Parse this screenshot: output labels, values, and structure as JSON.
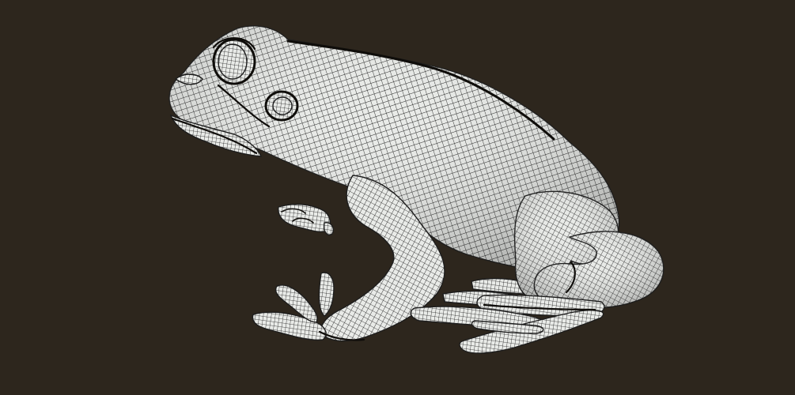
{
  "scene": {
    "subject_icon": "frog-wireframe-icon",
    "colors": {
      "background": "#2d261d",
      "surface": "#e9ebe8",
      "surface_shade": "#c5c8c4",
      "wire": "#1d1d1d",
      "deep_shadow": "#0f0d0a"
    }
  }
}
